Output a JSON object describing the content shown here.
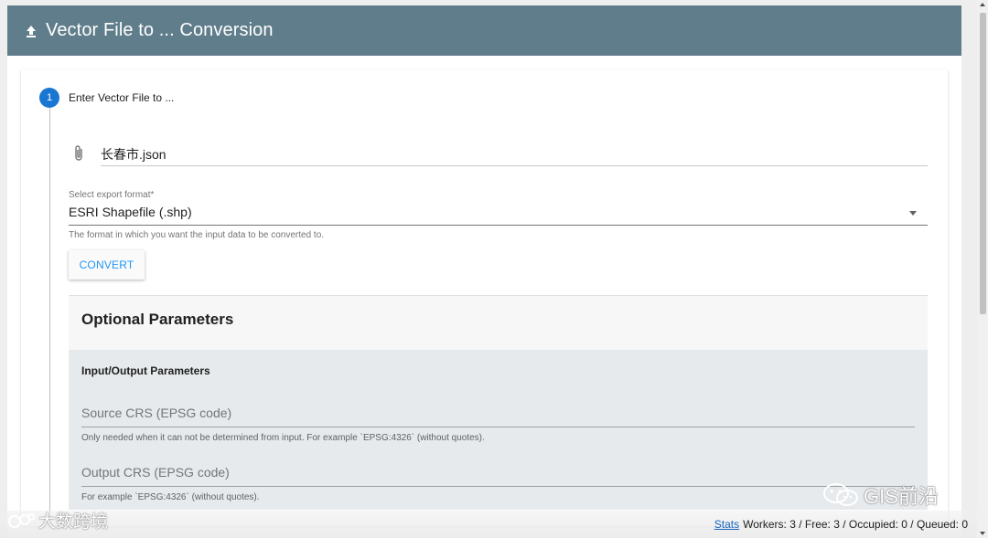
{
  "header": {
    "title": "Vector File to ... Conversion",
    "icon": "upload-icon"
  },
  "step": {
    "number": "1",
    "label": "Enter Vector File to ..."
  },
  "file_input": {
    "value": "长春市.json",
    "icon": "paperclip-icon"
  },
  "export_format": {
    "label": "Select export format*",
    "value": "ESRI Shapefile (.shp)",
    "hint": "The format in which you want the input data to be converted to."
  },
  "convert_button": {
    "label": "CONVERT"
  },
  "optional": {
    "title": "Optional Parameters",
    "io_title": "Input/Output Parameters",
    "source_crs": {
      "placeholder": "Source CRS (EPSG code)",
      "hint": "Only needed when it can not be determined from input. For example `EPSG:4326` (without quotes)."
    },
    "output_crs": {
      "placeholder": "Output CRS (EPSG code)",
      "hint": "For example `EPSG:4326` (without quotes)."
    }
  },
  "status": {
    "stats_link": "Stats",
    "text": "Workers: 3 / Free: 3 / Occupied: 0 / Queued: 0"
  },
  "watermarks": {
    "left": "大数跨境",
    "right": "GIS前沿"
  },
  "colors": {
    "header": "#607d8b",
    "accent": "#1976d2",
    "button_text": "#2196f3"
  }
}
